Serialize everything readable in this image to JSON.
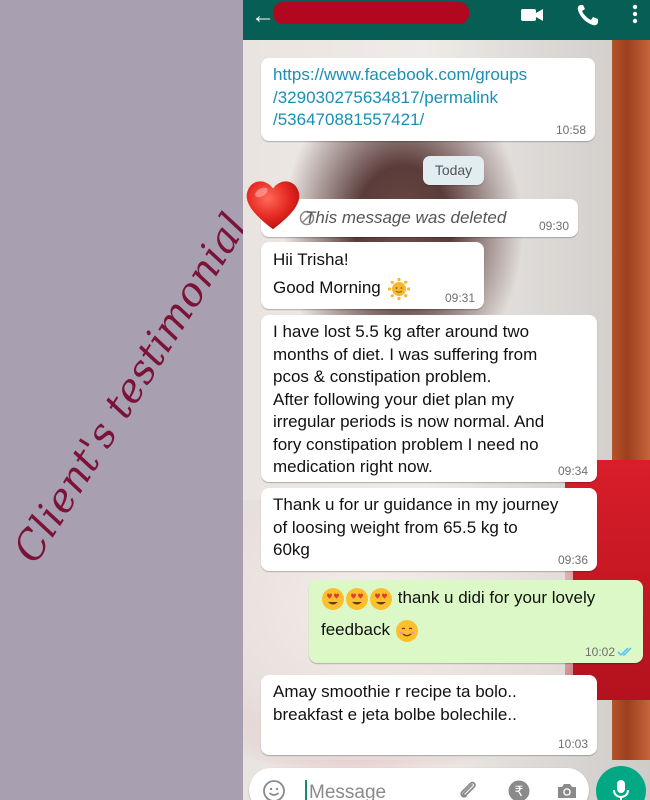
{
  "overlay": {
    "caption": "Client's testimonial"
  },
  "header": {
    "back_icon": "arrow-left-icon",
    "contact_name": "",
    "actions": [
      "video-call-icon",
      "phone-call-icon",
      "more-vertical-icon"
    ]
  },
  "messages": [
    {
      "direction": "incoming",
      "lines": [
        "https://www.facebook.com/groups",
        "/329030275634817/permalink",
        "/536470881557421/"
      ],
      "time": "10:58",
      "is_link": true
    },
    {
      "direction": "incoming",
      "lines": [
        "This message was deleted"
      ],
      "time": "09:30",
      "deleted": true
    },
    {
      "direction": "incoming",
      "lines": [
        "Hii Trisha!",
        "Good Morning"
      ],
      "time": "09:31"
    },
    {
      "direction": "incoming",
      "lines": [
        "I have lost 5.5 kg after around two",
        "months of diet. I was suffering from",
        "pcos & constipation problem.",
        "After following your diet plan my",
        "irregular periods is now normal. And",
        "fory constipation problem I need no",
        "medication right now."
      ],
      "time": "09:34"
    },
    {
      "direction": "incoming",
      "lines": [
        "Thank u for ur guidance in my journey",
        "of loosing weight from 65.5 kg to",
        "60kg"
      ],
      "time": "09:36"
    },
    {
      "direction": "outgoing",
      "lines": [
        "thank u didi for your lovely",
        "feedback"
      ],
      "time": "10:02",
      "status": "read"
    },
    {
      "direction": "incoming",
      "lines": [
        "Amay smoothie r recipe ta bolo..",
        "breakfast e jeta bolbe bolechile.."
      ],
      "time": "10:03"
    }
  ],
  "date_divider": "Today",
  "composer": {
    "placeholder": "Message",
    "icons": [
      "emoji-icon",
      "attach-icon",
      "rupee-payment-icon",
      "camera-icon"
    ],
    "send_icon": "mic-icon"
  },
  "colors": {
    "header_bg": "#075e54",
    "outgoing_bubble": "#dcf8c6",
    "incoming_bubble": "#ffffff",
    "link": "#1a8fb3",
    "caption": "#7b1238",
    "mic_button": "#00a884",
    "read_ticks": "#4fc3f7"
  }
}
